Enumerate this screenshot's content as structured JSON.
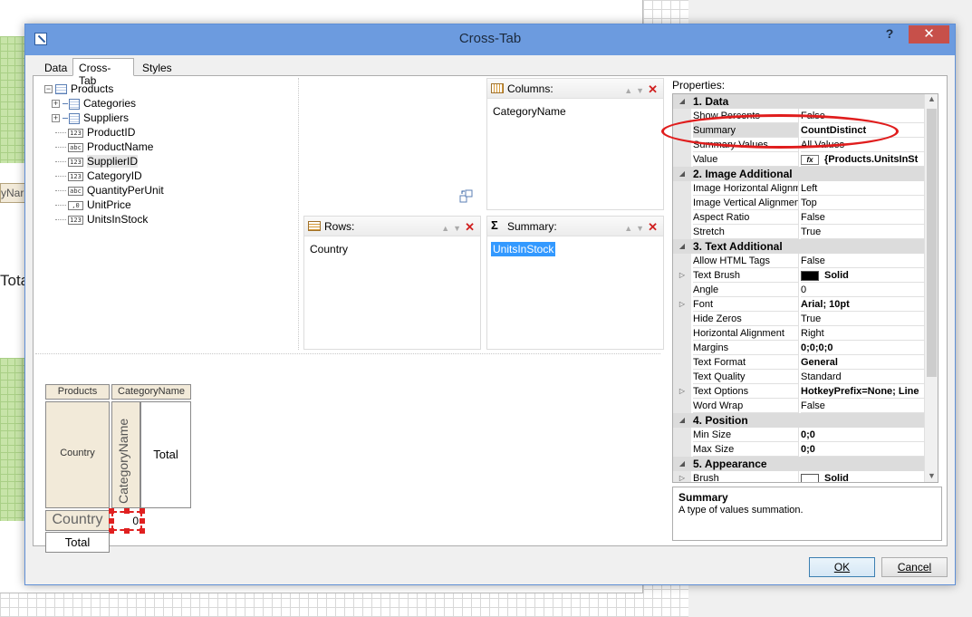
{
  "background": {
    "partial_label": "yNar",
    "partial_total": "Tota"
  },
  "dialog": {
    "title": "Cross-Tab",
    "help": "?",
    "close": "✕"
  },
  "tabs": [
    {
      "label": "Data",
      "active": false
    },
    {
      "label": "Cross-Tab",
      "active": true
    },
    {
      "label": "Styles",
      "active": false
    }
  ],
  "tree": {
    "root": "Products",
    "items": [
      {
        "label": "Categories",
        "kind": "relation"
      },
      {
        "label": "Suppliers",
        "kind": "relation"
      },
      {
        "label": "ProductID",
        "kind": "number"
      },
      {
        "label": "ProductName",
        "kind": "text"
      },
      {
        "label": "SupplierID",
        "kind": "number"
      },
      {
        "label": "CategoryID",
        "kind": "number"
      },
      {
        "label": "QuantityPerUnit",
        "kind": "text"
      },
      {
        "label": "UnitPrice",
        "kind": "decimal"
      },
      {
        "label": "UnitsInStock",
        "kind": "number"
      }
    ],
    "type_badges": {
      "number": "123",
      "text": "abc",
      "decimal": ",0"
    }
  },
  "columns": {
    "title": "Columns:",
    "items": [
      "CategoryName"
    ]
  },
  "rows": {
    "title": "Rows:",
    "items": [
      "Country"
    ]
  },
  "summary": {
    "title": "Summary:",
    "items": [
      "UnitsInStock"
    ]
  },
  "header_buttons": {
    "up": "▲",
    "down": "▼",
    "remove": "✕"
  },
  "preview": {
    "products": "Products",
    "category_name_top": "CategoryName",
    "country_rows": "Country",
    "category_name_vertical": "CategoryName",
    "total_col": "Total",
    "country_sum": "Country",
    "zero": "0",
    "total_row": "Total"
  },
  "properties": {
    "label": "Properties:",
    "categories": [
      {
        "name": "1. Data",
        "rows": [
          {
            "name": "Show Percents",
            "value": "False"
          },
          {
            "name": "Summary",
            "value": "CountDistinct",
            "bold": true,
            "selected": true
          },
          {
            "name": "Summary Values",
            "value": "All Values"
          },
          {
            "name": "Value",
            "value": "{Products.UnitsInSt",
            "bold": true,
            "icon": "fx"
          }
        ]
      },
      {
        "name": "2. Image  Additional",
        "rows": [
          {
            "name": "Image Horizontal Alignm",
            "value": "Left"
          },
          {
            "name": "Image Vertical Alignmen",
            "value": "Top"
          },
          {
            "name": "Aspect Ratio",
            "value": "False"
          },
          {
            "name": "Stretch",
            "value": "True"
          }
        ]
      },
      {
        "name": "3. Text  Additional",
        "rows": [
          {
            "name": "Allow HTML Tags",
            "value": "False"
          },
          {
            "name": "Text Brush",
            "value": "Solid",
            "bold": true,
            "expand": true,
            "swatch": "#000000"
          },
          {
            "name": "Angle",
            "value": "0"
          },
          {
            "name": "Font",
            "value": "Arial; 10pt",
            "bold": true,
            "expand": true
          },
          {
            "name": "Hide Zeros",
            "value": "True"
          },
          {
            "name": "Horizontal Alignment",
            "value": "Right"
          },
          {
            "name": "Margins",
            "value": "0;0;0;0",
            "bold": true
          },
          {
            "name": "Text Format",
            "value": "General",
            "bold": true
          },
          {
            "name": "Text Quality",
            "value": "Standard"
          },
          {
            "name": "Text Options",
            "value": "HotkeyPrefix=None; Line",
            "bold": true,
            "expand": true
          },
          {
            "name": "Word Wrap",
            "value": "False"
          }
        ]
      },
      {
        "name": "4. Position",
        "rows": [
          {
            "name": "Min Size",
            "value": "0;0",
            "bold": true
          },
          {
            "name": "Max Size",
            "value": "0;0",
            "bold": true
          }
        ]
      },
      {
        "name": "5. Appearance",
        "rows": [
          {
            "name": "Brush",
            "value": "Solid",
            "bold": true,
            "expand": true,
            "swatch": "#ffffff"
          }
        ]
      }
    ],
    "description": {
      "title": "Summary",
      "text": "A type of values summation."
    }
  },
  "buttons": {
    "ok": "OK",
    "cancel": "Cancel"
  },
  "colors": {
    "title_bar": "#6c9bdf",
    "highlight_ellipse": "#e01d1d",
    "selection": "#3399ff"
  }
}
